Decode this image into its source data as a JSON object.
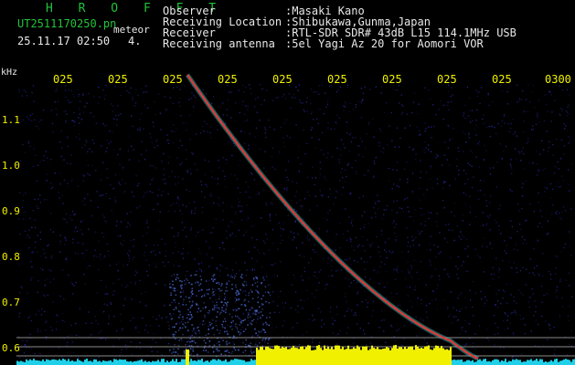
{
  "header": {
    "title": "H R O F F T",
    "filename": "UT2511170250.pn",
    "event_type": "meteor",
    "datetime": "25.11.17 02:50",
    "count": "4."
  },
  "station": [
    {
      "label": "Observer",
      "value": ":Masaki Kano"
    },
    {
      "label": "Receiving Location",
      "value": ":Shibukawa,Gunma,Japan"
    },
    {
      "label": "Receiver",
      "value": ":RTL-SDR SDR# 43dB L15 114.1MHz USB"
    },
    {
      "label": "Receiving antenna",
      "value": ":5el Yagi Az 20 for Aomori VOR"
    }
  ],
  "plot": {
    "unit": "kHz",
    "time_ticks": [
      "025",
      "025",
      "025",
      "025",
      "025",
      "025",
      "025",
      "025",
      "025",
      "0300"
    ],
    "freq_ticks": [
      "1.1",
      "1.0",
      "0.9",
      "0.8",
      "0.7",
      "0.6"
    ],
    "freq_values": [
      1.1,
      1.0,
      0.9,
      0.8,
      0.7,
      0.6
    ],
    "colors": {
      "background": "#000000",
      "noise": "#2a2aa8",
      "trace": "#e03a3a",
      "trace_halo": "#3ad0c8",
      "level_cyan": "#1fd0e8",
      "level_yellow": "#f0f000",
      "ref_lines": "#b8b8b8",
      "header_green": "#22c33a"
    }
  }
}
